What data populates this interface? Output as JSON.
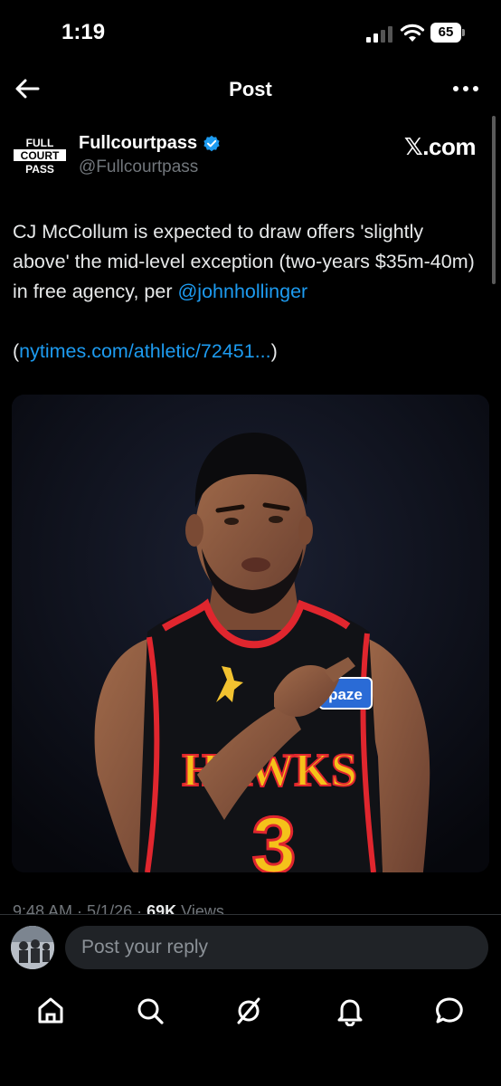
{
  "status_bar": {
    "time": "1:19",
    "battery": "65"
  },
  "nav": {
    "title": "Post"
  },
  "author": {
    "name": "Fullcourtpass",
    "handle": "@Fullcourtpass",
    "source": "𝕏.com",
    "logo_text": [
      "FULL",
      "COURT",
      "PASS"
    ]
  },
  "tweet": {
    "text": "CJ McCollum is expected to draw offers 'slightly above' the mid-level exception (two-years $35m-40m) in free agency, per ",
    "mention": "@johnhollinger",
    "link_open": "(",
    "link": "nytimes.com/athletic/72451...",
    "link_close": ")"
  },
  "media": {
    "jersey_text": "HAWKS",
    "jersey_number": "3",
    "sponsor": "paze"
  },
  "meta": {
    "time": "9:48 AM",
    "date": "5/1/26",
    "views_count": "69K",
    "views_label": "Views"
  },
  "reply": {
    "placeholder": "Post your reply"
  },
  "tab_bar": {
    "icons": [
      "home-icon",
      "search-icon",
      "grok-icon",
      "notifications-icon",
      "messages-icon"
    ]
  },
  "colors": {
    "accent": "#1d9bf0",
    "background": "#000000",
    "text": "#e7e9ea",
    "muted": "#71767b"
  }
}
